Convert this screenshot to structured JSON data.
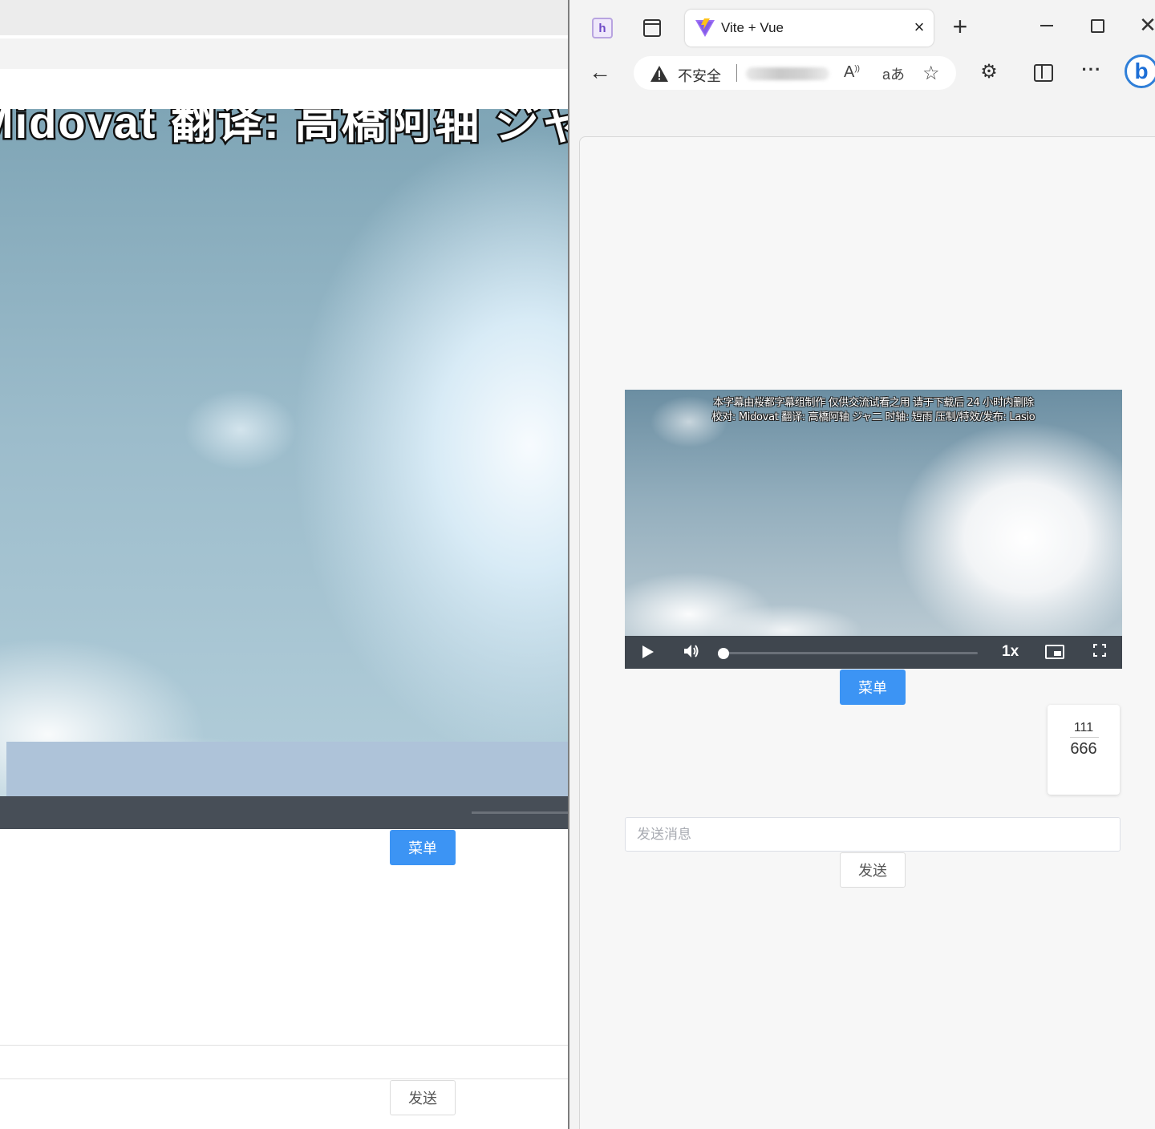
{
  "left_window": {
    "subtitle_fragment": "Midovat 翻译: 高橋阿轴 ジャ二 时轴: 厉",
    "menu_button_label": "菜单",
    "send_button_label": "发送"
  },
  "browser": {
    "tab": {
      "title": "Vite + Vue",
      "favicon": "vite-logo-icon",
      "close_symbol": "×"
    },
    "new_tab_symbol": "+",
    "window_controls": {
      "close_symbol": "✕"
    },
    "toolbar": {
      "back_symbol": "←",
      "security_label": "不安全",
      "read_aloud_symbol": "A",
      "translate_symbol": "aあ",
      "favorite_symbol": "☆",
      "extensions_symbol": "⚙",
      "more_symbol": "···",
      "bing_symbol": "b"
    }
  },
  "page": {
    "video": {
      "subtitle_line_1": "本字幕由桜都字幕组制作 仅供交流试看之用 请于下载后 24 小时内删除",
      "subtitle_line_2": "校对: Midovat 翻译: 高橋阿轴 ジャ二 时轴: 短雨 压制/特效/发布: Lasio",
      "speed_label": "1x",
      "progress_fraction": 0.0
    },
    "menu_button_label": "菜单",
    "message": {
      "user": "111",
      "text": "666"
    },
    "input": {
      "placeholder": "发送消息",
      "value": ""
    },
    "send_button_label": "发送"
  }
}
